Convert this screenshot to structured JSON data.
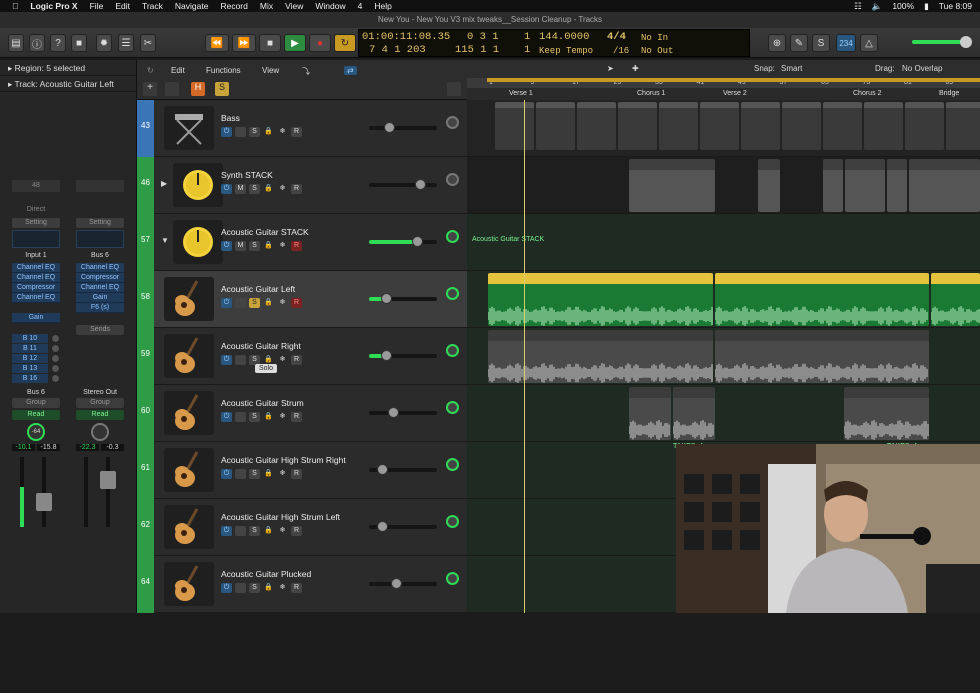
{
  "menubar": {
    "app": "Logic Pro X",
    "items": [
      "File",
      "Edit",
      "Track",
      "Navigate",
      "Record",
      "Mix",
      "View",
      "Window",
      "4",
      "Help"
    ],
    "battery": "100%",
    "clock": "Tue 8:09"
  },
  "window": {
    "title": "New You - New You V3 mix tweaks__Session Cleanup - Tracks"
  },
  "lcd": {
    "position_time": "01:00:11:08.35",
    "position_bars": "7  4  1  203",
    "bar_a": "0  3  1",
    "bar_b": "115  1  1",
    "tempo_top": "1",
    "tempo_bottom": "1",
    "tempo": "144.0000",
    "tempo_label": "Keep Tempo",
    "signature": "4/4",
    "division": "/16",
    "in_label": "No In",
    "out_label": "No Out",
    "cpu": "234"
  },
  "inspector": {
    "region": "Region: 5 selected",
    "track": "Track:  Acoustic Guitar Left"
  },
  "strips": [
    {
      "input": "Input 1",
      "setting": "Setting",
      "plugins": [
        "Channel EQ",
        "Channel EQ",
        "Compressor",
        "Channel EQ"
      ],
      "extra": "Gain",
      "sends": [
        "B 10",
        "B 11",
        "B 12",
        "B 13",
        "B 16"
      ],
      "output": "Bus 6",
      "group": "Group",
      "read": "Read",
      "pan": "-64",
      "level1": "-10.1",
      "level2": "-15.8",
      "mode": "Direct",
      "ch": "48"
    },
    {
      "input": "Bus 6",
      "setting": "Setting",
      "plugins": [
        "Channel EQ",
        "Compressor",
        "Channel EQ",
        "Gain",
        "F6 (s)"
      ],
      "sends_label": "Sends",
      "output": "Stereo Out",
      "group": "Group",
      "read": "Read",
      "level1": "-22.3",
      "level2": "-0.3"
    }
  ],
  "tracks_menu": {
    "edit": "Edit",
    "functions": "Functions",
    "view": "View",
    "snap_label": "Snap:",
    "snap": "Smart",
    "drag_label": "Drag:",
    "drag": "No Overlap"
  },
  "tracks": [
    {
      "num": "43",
      "name": "Bass",
      "icon": "keyboard-stand-icon",
      "color": "#3a76b6",
      "fader": 0.29,
      "green": false
    },
    {
      "num": "46",
      "name": "Synth STACK",
      "icon": "stack-knob-icon",
      "color": "#2e9b46",
      "fader": 0.75,
      "green": false,
      "folder": true
    },
    {
      "num": "57",
      "name": "Acoustic Guitar STACK",
      "icon": "stack-knob-icon",
      "color": "#2e9b46",
      "fader": 0.7,
      "green": true,
      "folder": true,
      "expanded": true
    },
    {
      "num": "58",
      "name": "Acoustic Guitar Left",
      "icon": "acoustic-guitar-icon",
      "color": "#2e9b46",
      "fader": 0.25,
      "green": true,
      "selected": true
    },
    {
      "num": "59",
      "name": "Acoustic Guitar Right",
      "icon": "acoustic-guitar-icon",
      "color": "#2e9b46",
      "fader": 0.25,
      "green": true
    },
    {
      "num": "60",
      "name": "Acoustic Guitar Strum",
      "icon": "acoustic-guitar-icon",
      "color": "#2e9b46",
      "fader": 0.36,
      "green": false
    },
    {
      "num": "61",
      "name": "Acoustic Guitar High Strum Right",
      "icon": "acoustic-guitar-icon",
      "color": "#2e9b46",
      "fader": 0.19,
      "green": false
    },
    {
      "num": "62",
      "name": "Acoustic Guitar High Strum Left",
      "icon": "acoustic-guitar-icon",
      "color": "#2e9b46",
      "fader": 0.19,
      "green": false
    },
    {
      "num": "64",
      "name": "Acoustic Guitar Plucked",
      "icon": "acoustic-guitar-icon",
      "color": "#2e9b46",
      "fader": 0.39,
      "green": false
    }
  ],
  "tooltip": "Solo",
  "ruler": {
    "bars": [
      "1",
      "9",
      "17",
      "25",
      "33",
      "41",
      "49",
      "57",
      "65",
      "73",
      "81",
      "89"
    ],
    "markers": [
      "Verse 1",
      "Chorus 1",
      "Verse 2",
      "Chorus 2",
      "Bridge"
    ]
  },
  "regions": {
    "stack_label": "Acoustic Guitar STACK",
    "agl": [
      "Acoustic Guitar_Left_COMP.1",
      "Acoustic Guitar_Left_COMP.9",
      "Acoustic Guitar"
    ],
    "agr": [
      "Acoustic Guitar_Right_COMP.1",
      "Acoustic Guitar_Right_COMP.9"
    ],
    "strum": [
      "Acoustic Guit",
      "Acoustic",
      "Acoustic Guitar_Strum_CO"
    ],
    "takes": [
      "TAKES_Acou",
      "TAKES_Acou"
    ],
    "synth": [
      "Synth STACK",
      "Pad",
      "Pad",
      "Synth ST",
      "Sy",
      "Synth STACK"
    ]
  }
}
